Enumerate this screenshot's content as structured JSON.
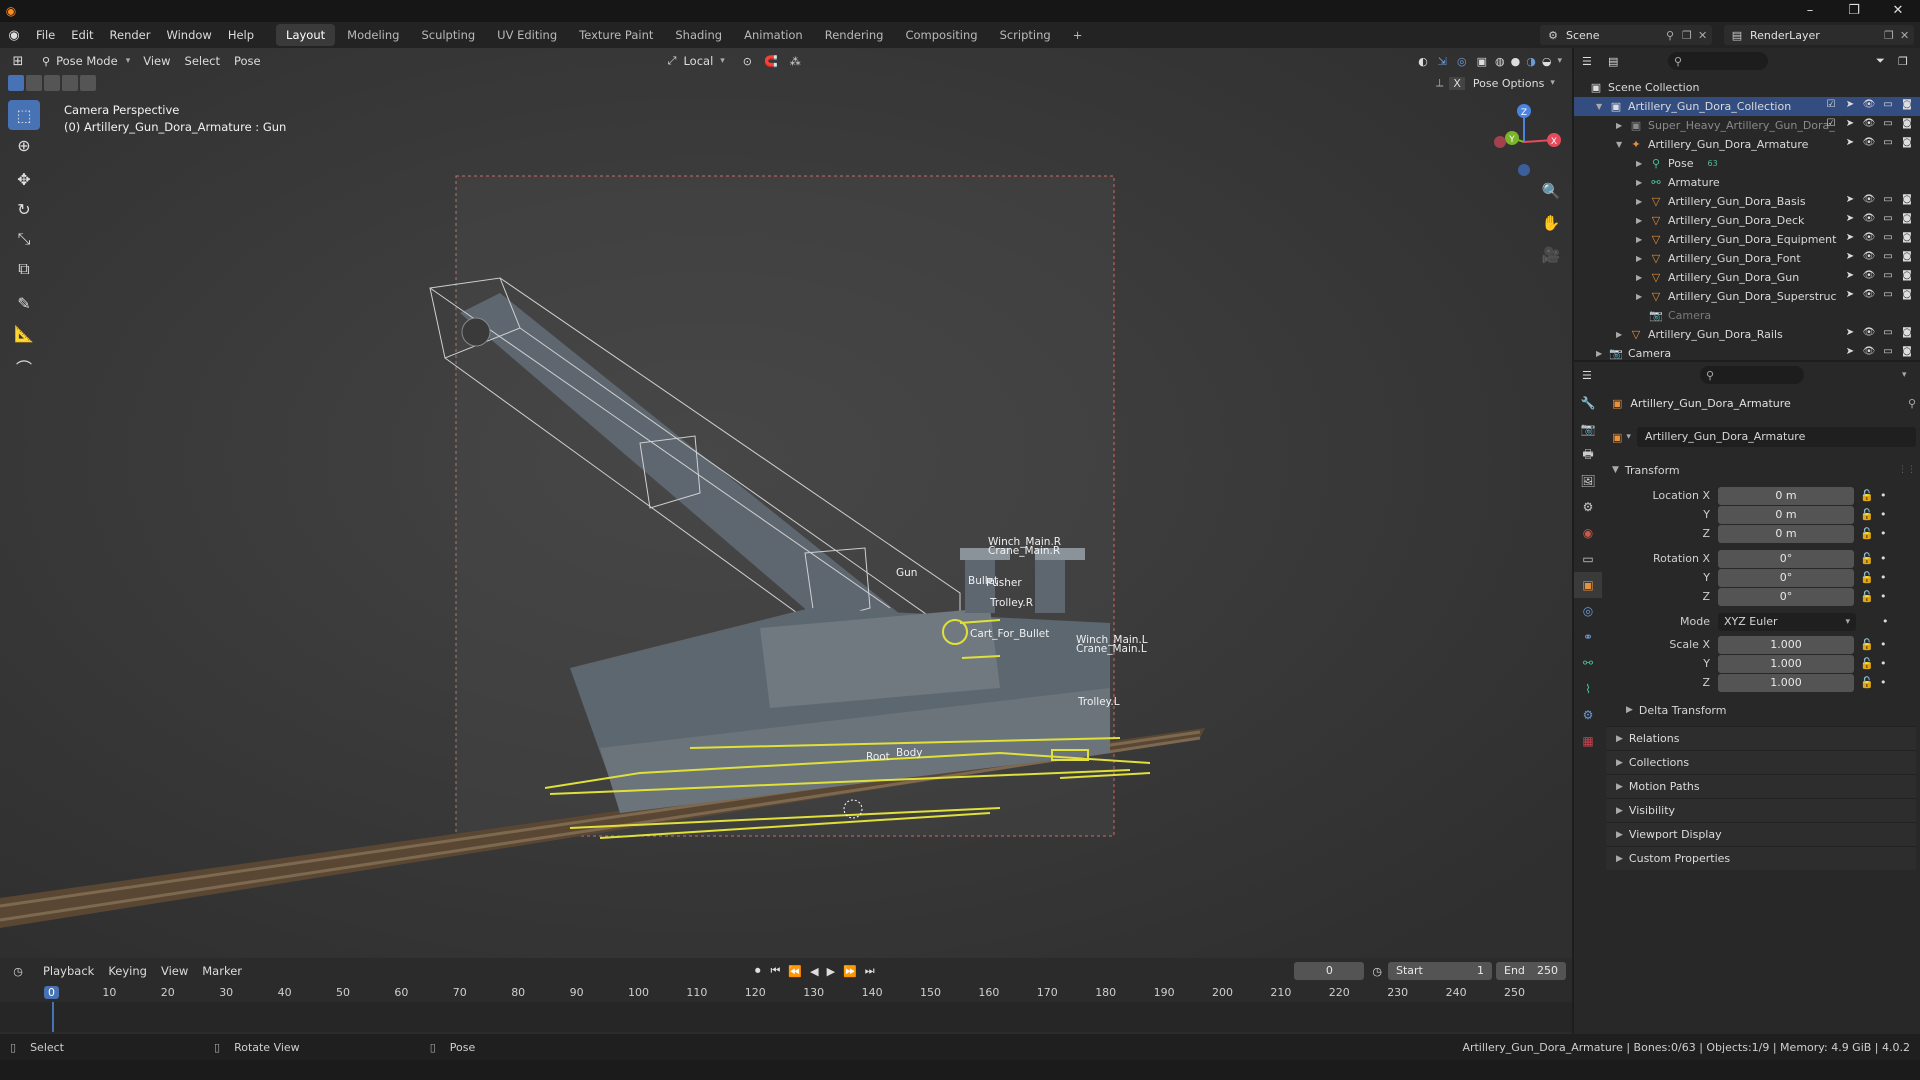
{
  "topbar": {
    "menus": [
      "File",
      "Edit",
      "Render",
      "Window",
      "Help"
    ],
    "workspaces": [
      "Layout",
      "Modeling",
      "Sculpting",
      "UV Editing",
      "Texture Paint",
      "Shading",
      "Animation",
      "Rendering",
      "Compositing",
      "Scripting",
      "+"
    ],
    "active_workspace": "Layout",
    "scene_name": "Scene",
    "render_layer": "RenderLayer"
  },
  "viewport": {
    "mode": "Pose Mode",
    "menus": [
      "View",
      "Select",
      "Pose"
    ],
    "transform_orientation": "Local",
    "pose_options": "Pose Options",
    "overlay_title": "Camera Perspective",
    "overlay_subtitle": "(0) Artillery_Gun_Dora_Armature : Gun",
    "gizmo_axes": {
      "z": "Z",
      "x": "X",
      "y": "Y"
    },
    "bone_labels": [
      "Winch_Main.R",
      "Crane_Main.R",
      "Gun",
      "Bullet",
      "Pusher",
      "Trolley.R",
      "Cart_For_Bullet",
      "Winch_Main.L",
      "Crane_Main.L",
      "Trolley.L",
      "Root",
      "Body"
    ]
  },
  "outliner": {
    "rows": [
      {
        "label": "Scene Collection",
        "indent": 0
      },
      {
        "label": "Artillery_Gun_Dora_Collection",
        "indent": 1,
        "selected": true
      },
      {
        "label": "Super_Heavy_Artillery_Gun_Dora_",
        "indent": 2,
        "dim": true
      },
      {
        "label": "Artillery_Gun_Dora_Armature",
        "indent": 2
      },
      {
        "label": "Pose",
        "indent": 3,
        "badge": "63"
      },
      {
        "label": "Armature",
        "indent": 3
      },
      {
        "label": "Artillery_Gun_Dora_Basis",
        "indent": 3
      },
      {
        "label": "Artillery_Gun_Dora_Deck",
        "indent": 3
      },
      {
        "label": "Artillery_Gun_Dora_Equipment",
        "indent": 3
      },
      {
        "label": "Artillery_Gun_Dora_Font",
        "indent": 3
      },
      {
        "label": "Artillery_Gun_Dora_Gun",
        "indent": 3
      },
      {
        "label": "Artillery_Gun_Dora_Superstruc",
        "indent": 3
      },
      {
        "label": "Camera",
        "indent": 3,
        "dim": true
      },
      {
        "label": "Artillery_Gun_Dora_Rails",
        "indent": 2
      },
      {
        "label": "Camera",
        "indent": 1
      }
    ]
  },
  "properties": {
    "object_name": "Artillery_Gun_Dora_Armature",
    "object_field": "Artillery_Gun_Dora_Armature",
    "transform": {
      "title": "Transform",
      "location_label": "Location X",
      "location": [
        "0 m",
        "0 m",
        "0 m"
      ],
      "rotation_label": "Rotation X",
      "rotation": [
        "0°",
        "0°",
        "0°"
      ],
      "mode_label": "Mode",
      "mode": "XYZ Euler",
      "scale_label": "Scale X",
      "scale": [
        "1.000",
        "1.000",
        "1.000"
      ],
      "y_label": "Y",
      "z_label": "Z",
      "delta": "Delta Transform"
    },
    "panels": [
      "Relations",
      "Collections",
      "Motion Paths",
      "Visibility",
      "Viewport Display",
      "Custom Properties"
    ]
  },
  "timeline": {
    "menus": [
      "Playback",
      "Keying",
      "View",
      "Marker"
    ],
    "current_frame": "0",
    "start_label": "Start",
    "start": "1",
    "end_label": "End",
    "end": "250",
    "ruler": [
      "0",
      "10",
      "20",
      "30",
      "40",
      "50",
      "60",
      "70",
      "80",
      "90",
      "100",
      "110",
      "120",
      "130",
      "140",
      "150",
      "160",
      "170",
      "180",
      "190",
      "200",
      "210",
      "220",
      "230",
      "240",
      "250"
    ]
  },
  "statusbar": {
    "select": "Select",
    "rotate": "Rotate View",
    "pose": "Pose",
    "info": "Artillery_Gun_Dora_Armature | Bones:0/63 | Objects:1/9 | Memory: 4.9 GiB | 4.0.2"
  },
  "colors": {
    "accent": "#4772b3",
    "bone_outline": "#e0e03a",
    "selected_row": "#334d80"
  }
}
